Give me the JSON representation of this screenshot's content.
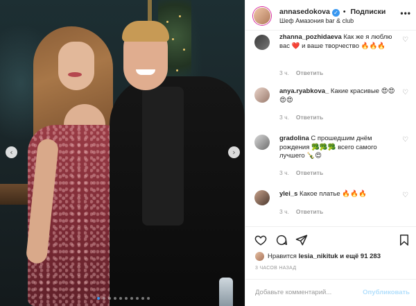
{
  "post": {
    "dots_count": 10,
    "active_dot": 0,
    "prev_glyph": "‹",
    "next_glyph": "›"
  },
  "header": {
    "username": "annasedokova",
    "verified_glyph": "✓",
    "separator": "•",
    "follow_label": "Подписки",
    "location": "Шеф Амазония bar & club",
    "more_glyph": "•••"
  },
  "comments": [
    {
      "username": "zhanna_pozhidaeva",
      "text": " Как же я люблю вас ❤️ и ваше творчество 🔥🔥🔥",
      "time": "3 ч.",
      "reply": "Ответить"
    },
    {
      "username": "anya.ryabkova_",
      "text": " Какие красивые 😍😍😍😍",
      "time": "3 ч.",
      "reply": "Ответить"
    },
    {
      "username": "gradolina",
      "text": " С прошедшим днём рождения 🥦🥦🥦 всего самого лучшего 🍾😍",
      "time": "3 ч.",
      "reply": "Ответить"
    },
    {
      "username": "ylei_s",
      "text": " Какое платье 🔥🔥🔥",
      "time": "3 ч.",
      "reply": "Ответить"
    }
  ],
  "comment_like_glyph": "♡",
  "likes": {
    "prefix": "Нравится ",
    "user": "lesia_nikituk",
    "suffix": " и ещё 91 283"
  },
  "time_ago": "3 ЧАСОВ НАЗАД",
  "composer": {
    "placeholder": "Добавьте комментарий...",
    "publish_label": "Опубликовать"
  },
  "icons": {
    "like": "heart-outline",
    "comment": "speech-bubble",
    "share": "paper-plane",
    "save": "bookmark"
  },
  "colors": {
    "link_blue": "#3897f0",
    "publish_disabled": "#b2dffc",
    "muted": "#999999"
  }
}
